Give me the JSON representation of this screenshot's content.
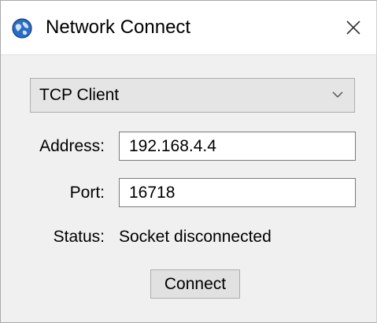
{
  "window": {
    "title": "Network Connect",
    "close_glyph": "×",
    "icon": "network-globe-icon"
  },
  "connection_type": {
    "selected": "TCP Client"
  },
  "address": {
    "label": "Address:",
    "value": "192.168.4.4"
  },
  "port": {
    "label": "Port:",
    "value": "16718"
  },
  "status": {
    "label": "Status:",
    "value": "Socket disconnected"
  },
  "actions": {
    "connect_label": "Connect"
  },
  "colors": {
    "window_bg": "#f0f0f0",
    "titlebar_bg": "#ffffff",
    "button_bg": "#e1e1e1",
    "border": "#adadad"
  }
}
